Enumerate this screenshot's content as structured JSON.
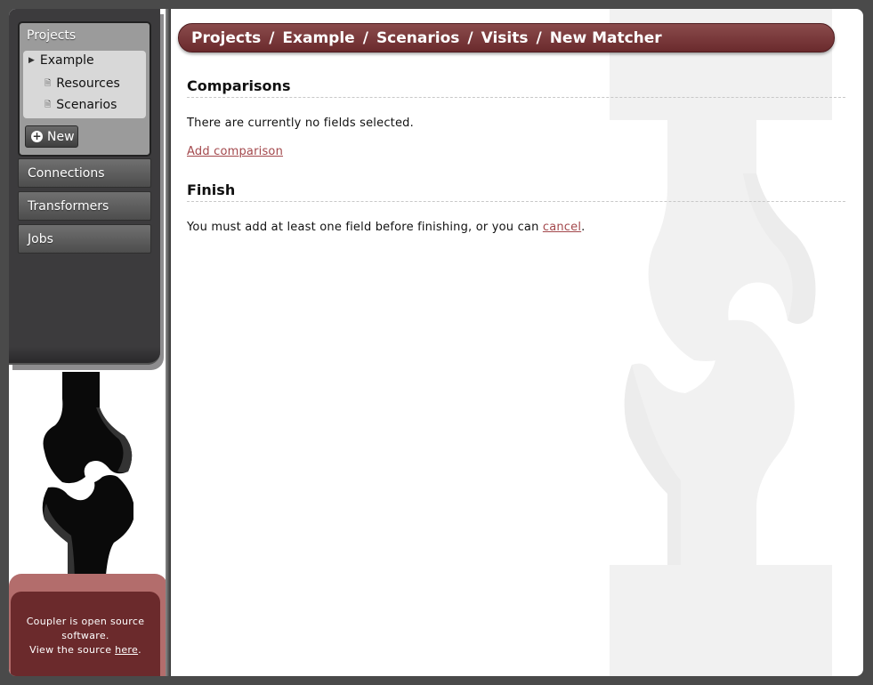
{
  "sidebar": {
    "projects_title": "Projects",
    "project_name": "Example",
    "project_items": [
      {
        "label": "Resources"
      },
      {
        "label": "Scenarios"
      }
    ],
    "new_button_label": "New",
    "nav_items": [
      {
        "label": "Connections"
      },
      {
        "label": "Transformers"
      },
      {
        "label": "Jobs"
      }
    ]
  },
  "footer": {
    "line1": "Coupler is open source",
    "line2": "software.",
    "line3_prefix": "View the source ",
    "line3_link": "here",
    "line3_suffix": "."
  },
  "breadcrumb": {
    "items": [
      "Projects",
      "Example",
      "Scenarios",
      "Visits",
      "New Matcher"
    ],
    "separator": "/"
  },
  "main": {
    "comparisons_heading": "Comparisons",
    "no_fields_text": "There are currently no fields selected.",
    "add_comparison_link": "Add comparison",
    "finish_heading": "Finish",
    "finish_prefix": "You must add at least one field before finishing, or you can ",
    "cancel_link": "cancel",
    "finish_suffix": "."
  },
  "colors": {
    "accent": "#6e2f31",
    "link": "#a3484c",
    "sidebar_bg": "#3c3b3d"
  },
  "icons": [
    "triangle-right-icon",
    "page-icon",
    "plus-circle-icon",
    "coupler-logo"
  ]
}
